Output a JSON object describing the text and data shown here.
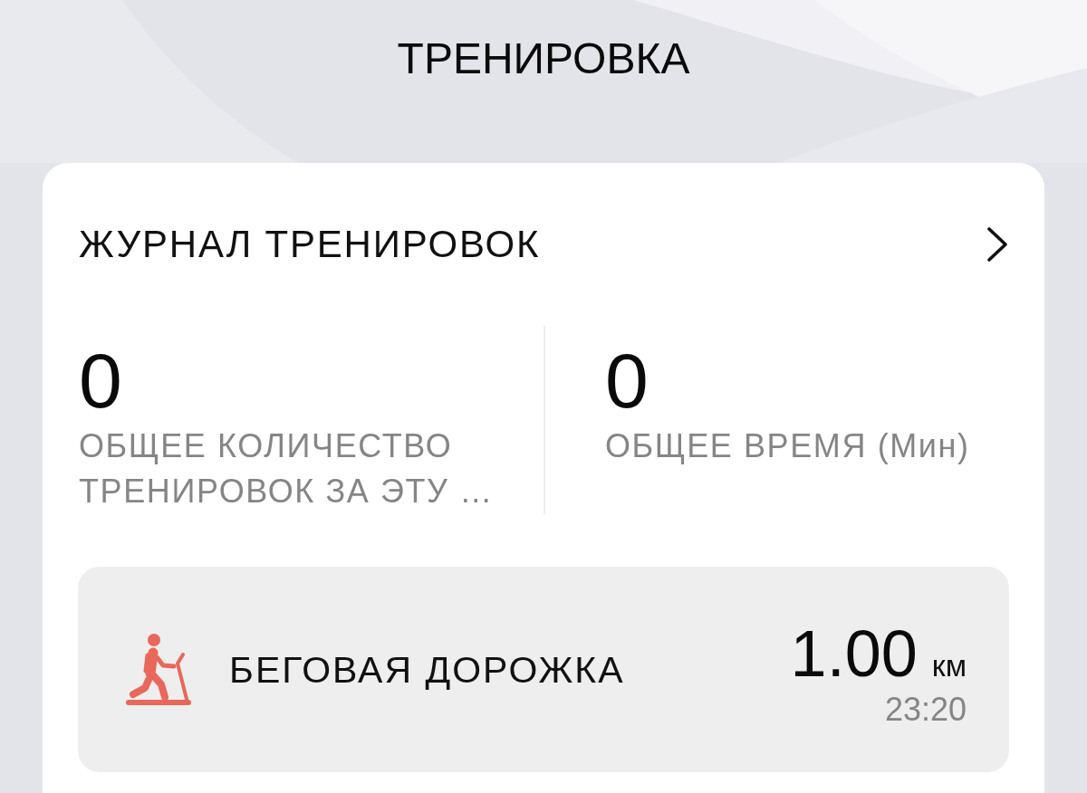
{
  "header": {
    "title": "ТРЕНИРОВКА"
  },
  "workout_log": {
    "title": "ЖУРНАЛ ТРЕНИРОВОК",
    "stats": [
      {
        "value": "0",
        "label": "ОБЩЕЕ КОЛИЧЕСТВО ТРЕНИРОВОК ЗА ЭТУ …"
      },
      {
        "value": "0",
        "label": "ОБЩЕЕ ВРЕМЯ (Мин)"
      }
    ],
    "activities": [
      {
        "kind": "treadmill",
        "name": "БЕГОВАЯ ДОРОЖКА",
        "distance": "1.00",
        "unit": "км",
        "time": "23:20"
      }
    ]
  }
}
